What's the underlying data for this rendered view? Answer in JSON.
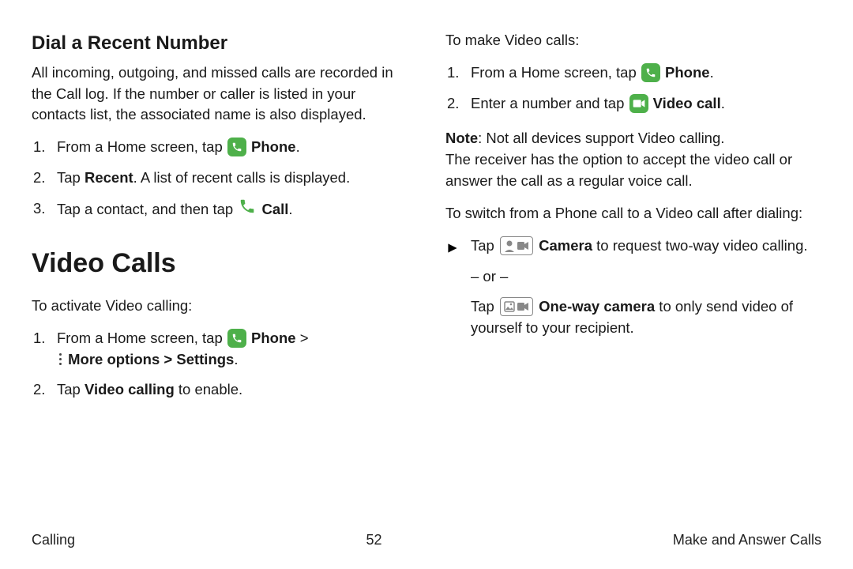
{
  "left": {
    "heading": "Dial a Recent Number",
    "intro": "All incoming, outgoing, and missed calls are recorded in the Call log. If the number or caller is listed in your contacts list, the associated name is also displayed.",
    "step1_a": "From a Home screen, tap ",
    "step1_b": "Phone",
    "step1_c": ".",
    "step2_a": "Tap ",
    "step2_b": "Recent",
    "step2_c": ". A list of recent calls is displayed.",
    "step3_a": "Tap a contact, and then tap ",
    "step3_b": "Call",
    "step3_c": ".",
    "bigheading": "Video Calls",
    "activate": "To activate Video calling:",
    "act1_a": "From a Home screen, tap ",
    "act1_b": "Phone",
    "act1_c": " > ",
    "act1_d": "More options > Settings",
    "act1_e": ".",
    "act2_a": "Tap ",
    "act2_b": "Video calling",
    "act2_c": " to enable."
  },
  "right": {
    "make": "To make Video calls:",
    "m1_a": "From a Home screen, tap ",
    "m1_b": "Phone",
    "m1_c": ".",
    "m2_a": "Enter a number and tap ",
    "m2_b": "Video call",
    "m2_c": ".",
    "note_a": "Note",
    "note_b": ": Not all devices support Video calling.",
    "note_line2": "The receiver has the option to accept the video call or answer the call as a regular voice call.",
    "switch": "To switch from a Phone call to a Video call after dialing:",
    "sw1_a": "Tap ",
    "sw1_b": "Camera",
    "sw1_c": " to request two-way video calling.",
    "or": "– or –",
    "sw2_a": "Tap ",
    "sw2_b": "One-way camera",
    "sw2_c": " to only send video of yourself to your recipient."
  },
  "footer": {
    "left": "Calling",
    "center": "52",
    "right": "Make and Answer Calls"
  }
}
